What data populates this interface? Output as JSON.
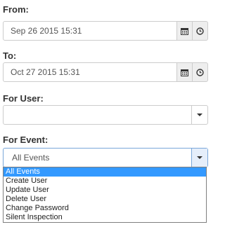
{
  "from": {
    "label": "From:",
    "value": "Sep 26 2015 15:31",
    "calendar_icon": "calendar-icon",
    "clock_icon": "clock-icon"
  },
  "to": {
    "label": "To:",
    "value": "Oct 27 2015 15:31",
    "calendar_icon": "calendar-icon",
    "clock_icon": "clock-icon"
  },
  "for_user": {
    "label": "For User:",
    "value": ""
  },
  "for_event": {
    "label": "For Event:",
    "value": "All Events",
    "options": [
      "All Events",
      "Create User",
      "Update User",
      "Delete User",
      "Change Password",
      "Silent Inspection"
    ],
    "selected_index": 0
  },
  "colors": {
    "highlight": "#3399ff",
    "border": "#cccccc",
    "addon_bg": "#eeeeee"
  }
}
